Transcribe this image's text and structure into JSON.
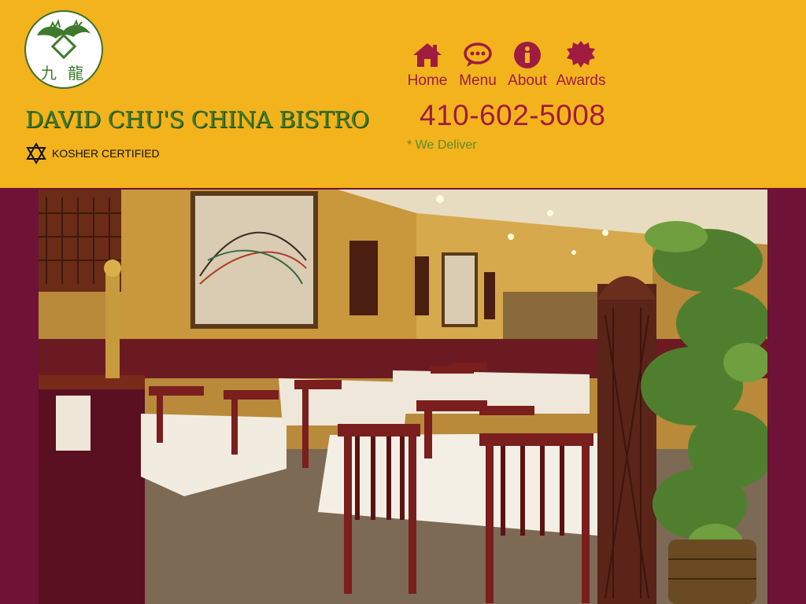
{
  "brand": {
    "name": "DAVID CHU'S CHINA BISTRO",
    "logo_text": "九 龍",
    "kosher_label": "KOSHER CERTIFIED"
  },
  "nav": {
    "items": [
      {
        "label": "Home",
        "icon": "home-icon"
      },
      {
        "label": "Menu",
        "icon": "chat-bubble-icon"
      },
      {
        "label": "About",
        "icon": "info-icon"
      },
      {
        "label": "Awards",
        "icon": "award-seal-icon"
      }
    ]
  },
  "contact": {
    "phone": "410-602-5008",
    "delivery_note": "* We Deliver"
  },
  "colors": {
    "header_bg": "#f3b31d",
    "accent": "#a01b40",
    "brand_green": "#3f7a2c",
    "page_bg": "#6e1236"
  },
  "hero": {
    "image_subject": "restaurant dining room interior"
  }
}
